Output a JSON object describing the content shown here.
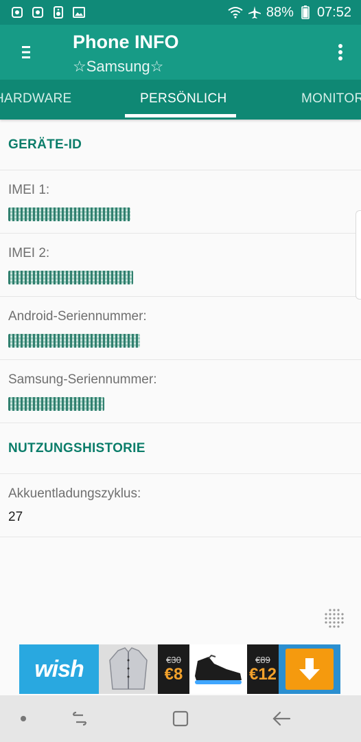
{
  "status_bar": {
    "battery": "88%",
    "time": "07:52",
    "icons": [
      "app-notification-icon",
      "app-notification-icon",
      "speaker-icon",
      "image-icon",
      "wifi-icon",
      "airplane-icon",
      "battery-icon"
    ]
  },
  "app_bar": {
    "title": "Phone INFO",
    "subtitle": "☆Samsung☆"
  },
  "tabs": [
    {
      "label": "HARDWARE",
      "active": false
    },
    {
      "label": "PERSÖNLICH",
      "active": true
    },
    {
      "label": "MONITOR",
      "active": false
    }
  ],
  "sections": [
    {
      "title": "GERÄTE-ID",
      "items": [
        {
          "label": "IMEI 1:",
          "value": ""
        },
        {
          "label": "IMEI 2:",
          "value": ""
        },
        {
          "label": "Android-Seriennummer:",
          "value": ""
        },
        {
          "label": "Samsung-Seriennummer:",
          "value": ""
        }
      ]
    },
    {
      "title": "NUTZUNGSHISTORIE",
      "items": [
        {
          "label": "Akkuentladungszyklus:",
          "value": "27"
        }
      ]
    }
  ],
  "ad": {
    "brand": "wish",
    "offers": [
      {
        "old_price": "€30",
        "new_price": "€8"
      },
      {
        "old_price": "€89",
        "new_price": "€12"
      }
    ]
  },
  "colors": {
    "app_bar": "#179b86",
    "status_bar": "#108a78",
    "tabs": "#0f8874",
    "section_title": "#0b7d6a"
  }
}
